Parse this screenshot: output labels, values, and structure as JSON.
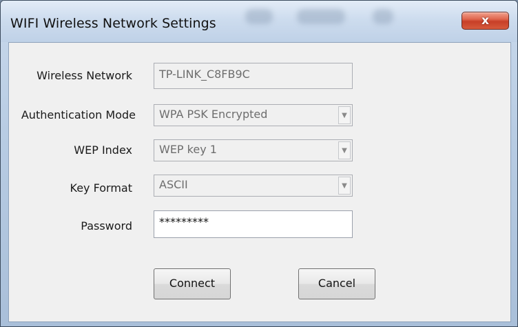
{
  "window": {
    "title": "WIFI Wireless Network Settings",
    "close_label": "x"
  },
  "form": {
    "wireless_network": {
      "label": "Wireless Network",
      "value": "TP-LINK_C8FB9C"
    },
    "authentication_mode": {
      "label": "Authentication Mode",
      "value": "WPA PSK Encrypted"
    },
    "wep_index": {
      "label": "WEP Index",
      "value": "WEP key 1"
    },
    "key_format": {
      "label": "Key Format",
      "value": "ASCII"
    },
    "password": {
      "label": "Password",
      "value": "*********"
    }
  },
  "buttons": {
    "connect_label": "Connect",
    "cancel_label": "Cancel"
  },
  "icons": {
    "dropdown": "chevron-down-icon",
    "close": "close-icon"
  },
  "colors": {
    "close_button": "#c73f27",
    "titlebar": "#cddcee",
    "client_background": "#f0f0f0"
  }
}
